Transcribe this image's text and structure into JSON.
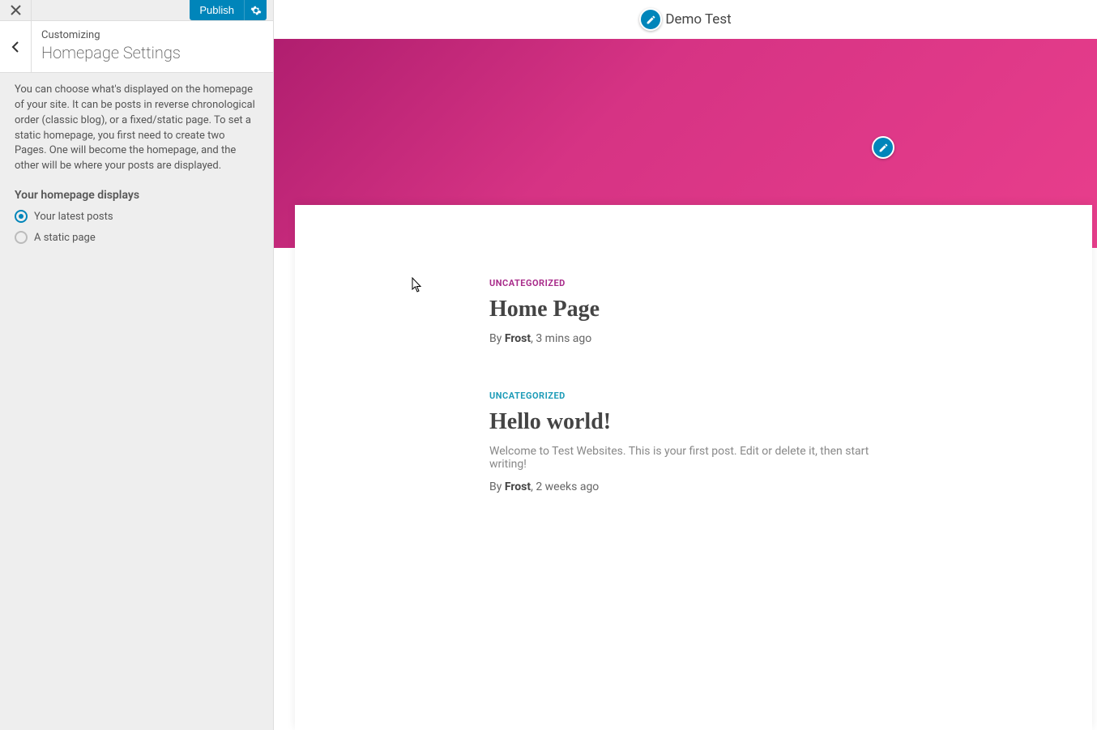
{
  "actions": {
    "publish_label": "Publish"
  },
  "panel": {
    "subtitle": "Customizing",
    "title": "Homepage Settings",
    "description": "You can choose what's displayed on the homepage of your site. It can be posts in reverse chronological order (classic blog), or a fixed/static page. To set a static homepage, you first need to create two Pages. One will become the homepage, and the other will be where your posts are displayed.",
    "section_label": "Your homepage displays",
    "options": {
      "latest_posts": "Your latest posts",
      "static_page": "A static page"
    }
  },
  "preview": {
    "site_title": "Demo Test",
    "posts": [
      {
        "category": "UNCATEGORIZED",
        "title": "Home Page",
        "by_prefix": "By ",
        "author": "Frost",
        "date": ", 3 mins ago"
      },
      {
        "category": "UNCATEGORIZED",
        "title": "Hello world!",
        "excerpt": "Welcome to Test Websites. This is your first post. Edit or delete it, then start writing!",
        "by_prefix": "By ",
        "author": "Frost",
        "date": ", 2 weeks ago"
      }
    ]
  }
}
